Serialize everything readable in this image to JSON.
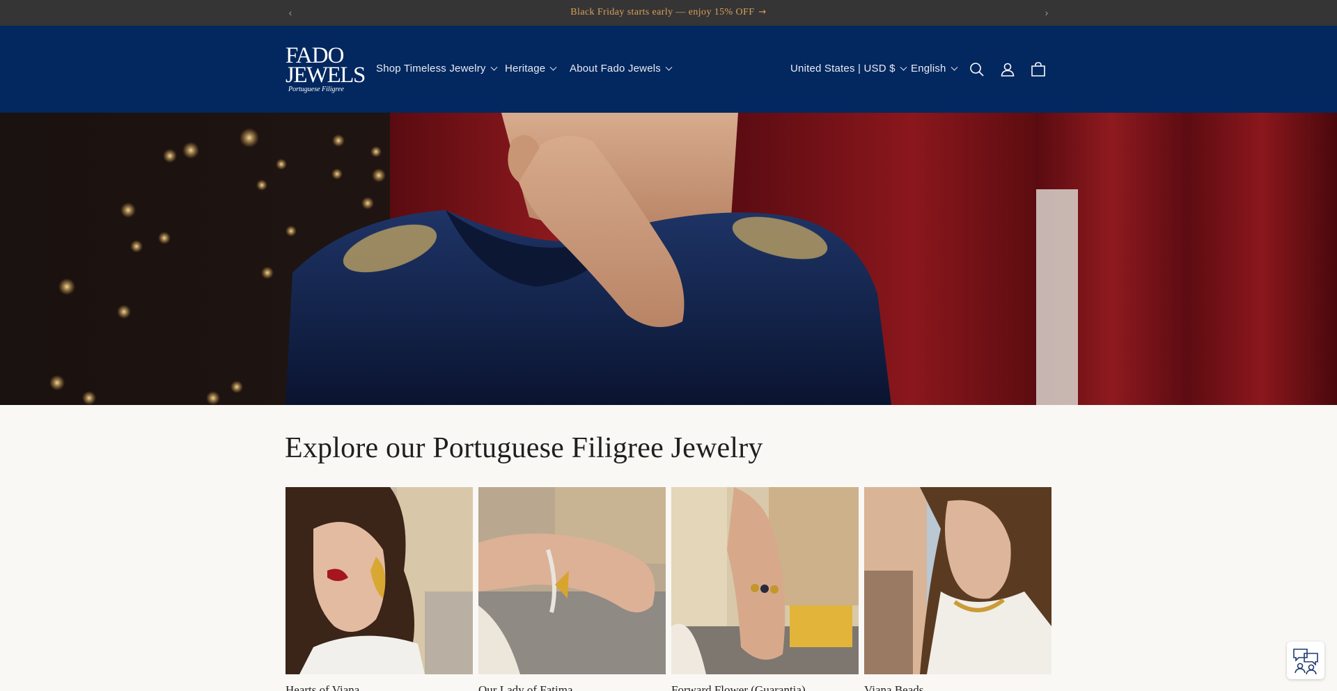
{
  "announcement": {
    "text": "Black Friday starts early — enjoy 15% OFF",
    "arrow_glyph": "→",
    "prev_icon": "chevron-left-icon",
    "next_icon": "chevron-right-icon",
    "text_color": "#d9a05c",
    "background": "#353535"
  },
  "header": {
    "background": "#03275f",
    "logo": {
      "line1": "FADO",
      "line2": "JEWELS",
      "tagline": "Portuguese Filigree"
    },
    "nav": [
      {
        "label": "Shop Timeless Jewelry"
      },
      {
        "label": "Heritage"
      },
      {
        "label": "About Fado Jewels"
      }
    ],
    "localization": {
      "country": "United States | USD $",
      "language": "English"
    },
    "icons": [
      "search-icon",
      "account-icon",
      "cart-icon"
    ]
  },
  "collections": {
    "title": "Explore our Portuguese Filigree Jewelry",
    "items": [
      {
        "label": "Hearts of Viana"
      },
      {
        "label": "Our Lady of Fatima"
      },
      {
        "label": "Forward Flower (Guarantia)"
      },
      {
        "label": "Viana Beads"
      }
    ]
  },
  "chat_widget": {
    "icon": "chat-support-icon"
  }
}
